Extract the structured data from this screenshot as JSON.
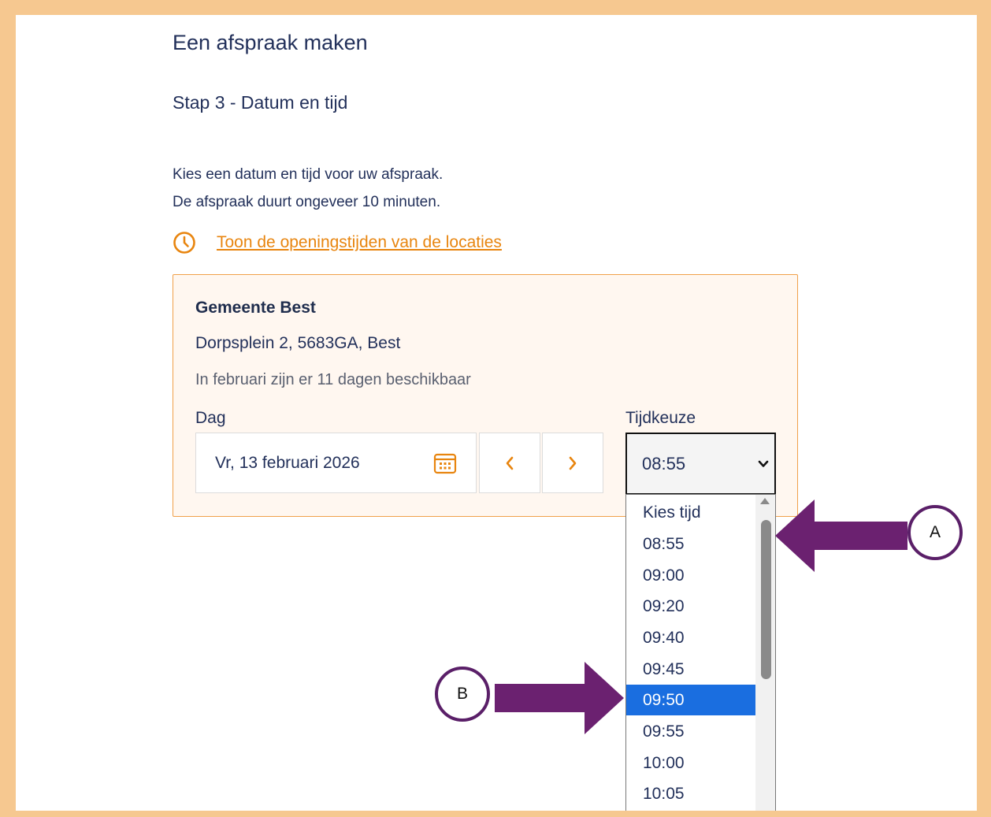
{
  "page": {
    "title": "Een afspraak maken",
    "step": "Stap 3 - Datum en tijd",
    "intro_line1": "Kies een datum en tijd voor uw afspraak.",
    "intro_line2": "De afspraak duurt ongeveer 10 minuten.",
    "hours_link": "Toon de openingstijden van de locaties"
  },
  "location": {
    "name": "Gemeente Best",
    "address": "Dorpsplein 2, 5683GA, Best",
    "availability": "In februari zijn er 11 dagen beschikbaar"
  },
  "form": {
    "day_label": "Dag",
    "day_value": "Vr, 13 februari 2026",
    "time_label": "Tijdkeuze",
    "time_value": "08:55"
  },
  "dropdown": {
    "options": [
      "Kies tijd",
      "08:55",
      "09:00",
      "09:20",
      "09:40",
      "09:45",
      "09:50",
      "09:55",
      "10:00",
      "10:05"
    ],
    "highlighted": "09:50"
  },
  "annotations": {
    "callout_a": "A",
    "callout_b": "B"
  },
  "colors": {
    "accent": "#e8850f",
    "frame": "#f6c890",
    "highlight": "#1a6ee0",
    "annotation": "#6b2170"
  }
}
